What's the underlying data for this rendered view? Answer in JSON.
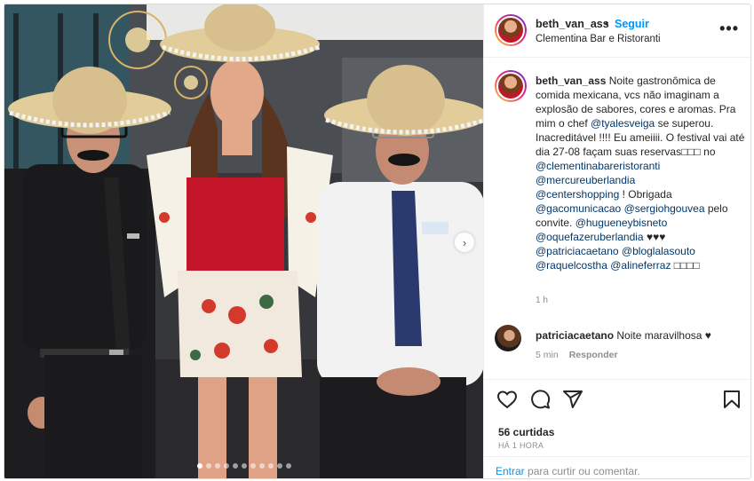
{
  "post": {
    "username": "beth_van_ass",
    "separator": "•",
    "follow_label": "Seguir",
    "location": "Clementina Bar e Ristoranti",
    "more_label": "•••",
    "next_label": "›"
  },
  "caption": {
    "username": "beth_van_ass",
    "parts": [
      " Noite gastronômica de comida mexicana, vcs não imaginam a explosão de sabores, cores e aromas. Pra mim o chef ",
      "@tyalesveiga",
      " se superou. Inacreditável !!!! Eu ameiiii. O festival vai até dia 27-08 façam suas reservas□□□ no ",
      "@clementinabareristoranti",
      "@mercureuberlandia",
      "@centershopping",
      " ! Obrigada ",
      "@gacomunicacao",
      "@sergiohgouvea",
      " pelo convite. ",
      "@hugueneybisneto",
      "@oquefazeruberlandia",
      " ♥♥♥ ",
      "@patriciacaetano",
      "@bloglalasouto",
      "@raquelcostha",
      "@alineferraz",
      " □□□□"
    ],
    "time": "1 h"
  },
  "comment": {
    "username": "patriciacaetano",
    "text": " Noite maravilhosa ♥",
    "time": "5 min",
    "reply_label": "Responder"
  },
  "actions": {
    "icons": [
      "heart-icon",
      "comment-icon",
      "share-icon",
      "bookmark-icon"
    ],
    "likes": "56 curtidas",
    "date": "HÁ 1 HORA"
  },
  "login_bar": {
    "enter_label": "Entrar",
    "rest": " para curtir ou comentar."
  },
  "carousel": {
    "total": 11,
    "active": 1
  },
  "colors": {
    "link": "#0095f6",
    "mention": "#00376b",
    "muted": "#8e8e8e"
  }
}
